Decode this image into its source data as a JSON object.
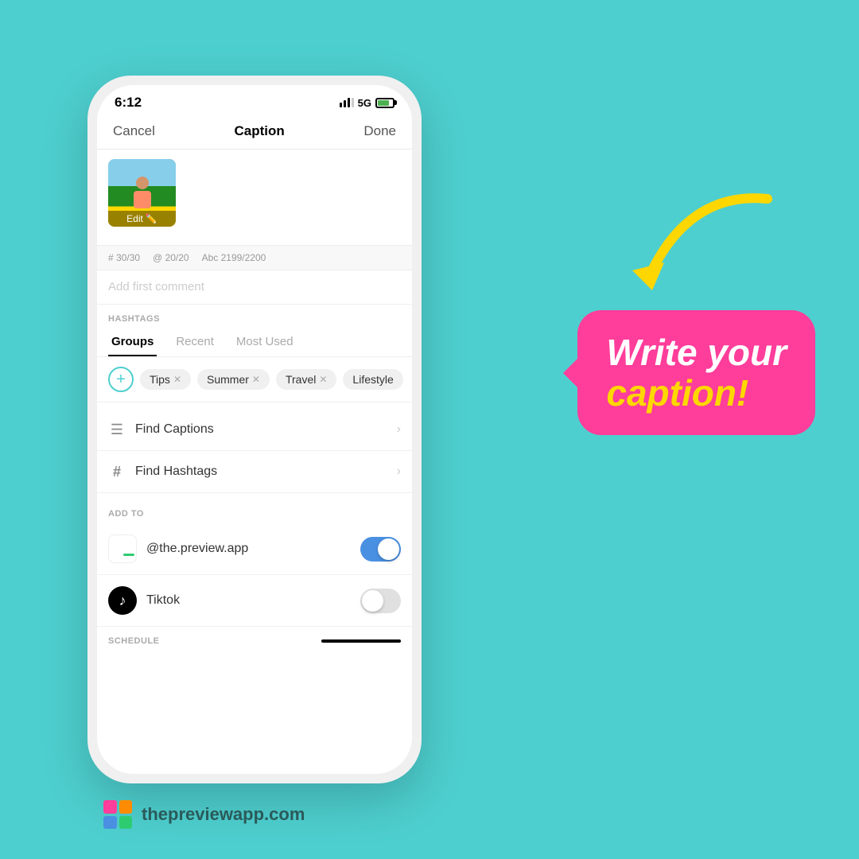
{
  "background_color": "#4ECFCF",
  "phone": {
    "status_bar": {
      "time": "6:12",
      "signal": "...",
      "network": "5G",
      "battery_level": 75
    },
    "nav": {
      "cancel_label": "Cancel",
      "title": "Caption",
      "done_label": "Done"
    },
    "caption_area": {
      "edit_label": "Edit",
      "placeholder": ""
    },
    "char_counts": {
      "hashtags": "# 30/30",
      "mentions": "@ 20/20",
      "chars": "Abc 2199/2200"
    },
    "comment_placeholder": "Add first comment",
    "hashtags": {
      "section_label": "HASHTAGS",
      "tabs": [
        {
          "label": "Groups",
          "active": true
        },
        {
          "label": "Recent",
          "active": false
        },
        {
          "label": "Most Used",
          "active": false
        }
      ],
      "chips": [
        {
          "label": "Tips"
        },
        {
          "label": "Summer"
        },
        {
          "label": "Travel"
        },
        {
          "label": "Lifestyle"
        }
      ]
    },
    "menu_items": [
      {
        "icon": "list-icon",
        "label": "Find Captions",
        "icon_char": "≡",
        "hash": false
      },
      {
        "icon": "hashtag-icon",
        "label": "Find Hashtags",
        "icon_char": "#",
        "hash": true
      }
    ],
    "add_to": {
      "label": "ADD TO",
      "items": [
        {
          "name": "@the.preview.app",
          "toggle_on": true
        },
        {
          "name": "Tiktok",
          "toggle_on": false
        }
      ]
    },
    "schedule_label": "SCHEDULE"
  },
  "annotation": {
    "bubble_line1": "Write your",
    "bubble_line2": "caption!"
  },
  "footer": {
    "website": "thepreviewapp.com"
  }
}
